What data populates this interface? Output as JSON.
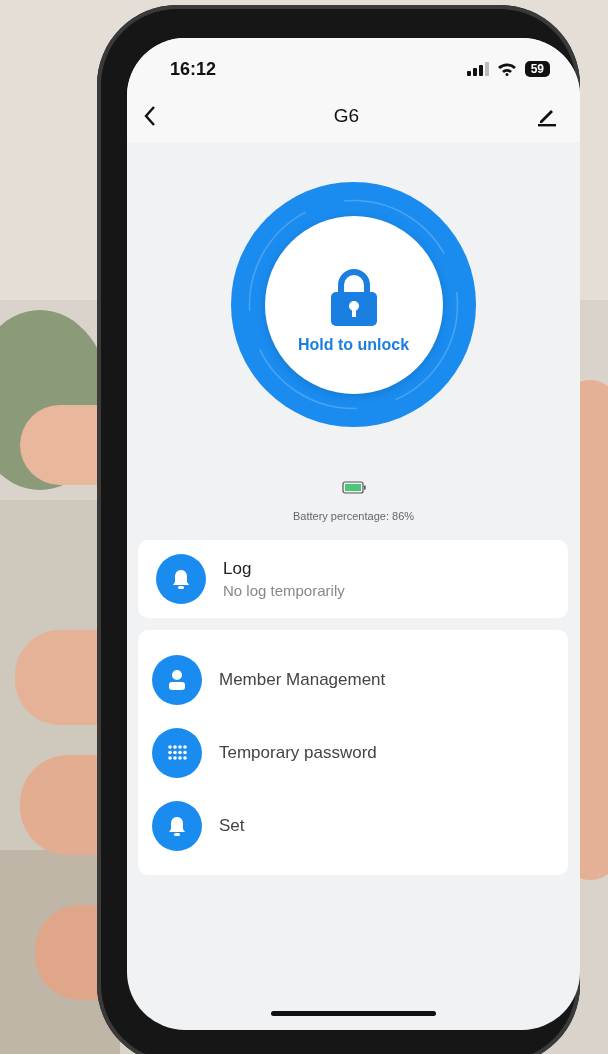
{
  "status_bar": {
    "time": "16:12",
    "battery": "59"
  },
  "nav": {
    "title": "G6"
  },
  "unlock": {
    "label": "Hold to unlock"
  },
  "battery": {
    "text": "Battery percentage: 86%"
  },
  "log": {
    "title": "Log",
    "subtitle": "No log temporarily"
  },
  "menu": [
    {
      "label": "Member Management"
    },
    {
      "label": "Temporary password"
    },
    {
      "label": "Set"
    }
  ]
}
